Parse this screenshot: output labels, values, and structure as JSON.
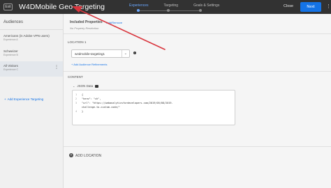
{
  "header": {
    "exit_label": "Exit",
    "title": "W4DMobile Geo Targeting",
    "steps": [
      {
        "label": "Experiences",
        "active": true
      },
      {
        "label": "Targeting",
        "active": false
      },
      {
        "label": "Goals & Settings",
        "active": false
      }
    ],
    "close_label": "Close",
    "next_label": "Next",
    "more_icon": "more-vertical-icon"
  },
  "sidebar": {
    "title": "Audiences",
    "items": [
      {
        "name": "Americans (in Adobe VPN users)",
        "sub": "Experience A",
        "selected": false
      },
      {
        "name": "Schweizer",
        "sub": "Experience B",
        "selected": false
      },
      {
        "name": "All Visitors",
        "sub": "Experience C",
        "selected": true
      }
    ],
    "add_experience_label": "Add Experience Targeting"
  },
  "main": {
    "included_properties_label": "Included Properties",
    "add_remove_label": "Add/Remove",
    "no_restriction": "No Property Restriction",
    "location_label": "LOCATION 1",
    "location_value": "w4dmobile-targeting1",
    "add_refinements_label": "Add Audience Refinements",
    "content_label": "CONTENT",
    "json_label": "JSON Data",
    "code_lines": [
      {
        "n": "1",
        "text": "{"
      },
      {
        "n": "2",
        "text": "  \"hero\": \"ch\","
      },
      {
        "n": "3",
        "text": "  \"url\": \"https://webanalyticsfordevelopers.com/2019/05/08/2019-"
      },
      {
        "n": "",
        "text": "  challenge-to-custom-code/\""
      },
      {
        "n": "4",
        "text": "}"
      }
    ],
    "add_location_label": "ADD LOCATION"
  },
  "colors": {
    "topbar": "#323232",
    "accent": "#1473e6",
    "annotation_arrow": "#d9363e"
  }
}
